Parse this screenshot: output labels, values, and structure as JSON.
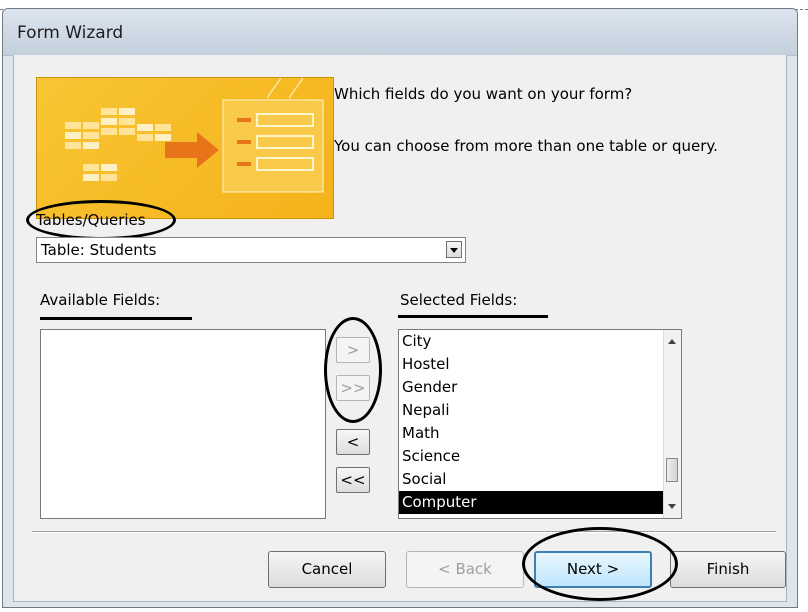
{
  "window": {
    "title": "Form Wizard"
  },
  "intro": {
    "question": "Which fields do you want on your form?",
    "subtext": "You can choose from more than one table or query."
  },
  "tables_queries": {
    "label": "Tables/Queries",
    "selected": "Table: Students"
  },
  "available_fields": {
    "label": "Available Fields:",
    "items": []
  },
  "selected_fields": {
    "label": "Selected Fields:",
    "items": [
      "City",
      "Hostel",
      "Gender",
      "Nepali",
      "Math",
      "Science",
      "Social",
      "Computer"
    ],
    "highlighted": "Computer"
  },
  "move_buttons": {
    "add_one": ">",
    "add_all": ">>",
    "remove_one": "<",
    "remove_all": "<<"
  },
  "footer": {
    "cancel": "Cancel",
    "back": "< Back",
    "next": "Next >",
    "finish": "Finish"
  },
  "colors": {
    "image_bg": "#f5b21a",
    "selection_bg": "#000000",
    "default_button_border": "#3c7fb1"
  }
}
